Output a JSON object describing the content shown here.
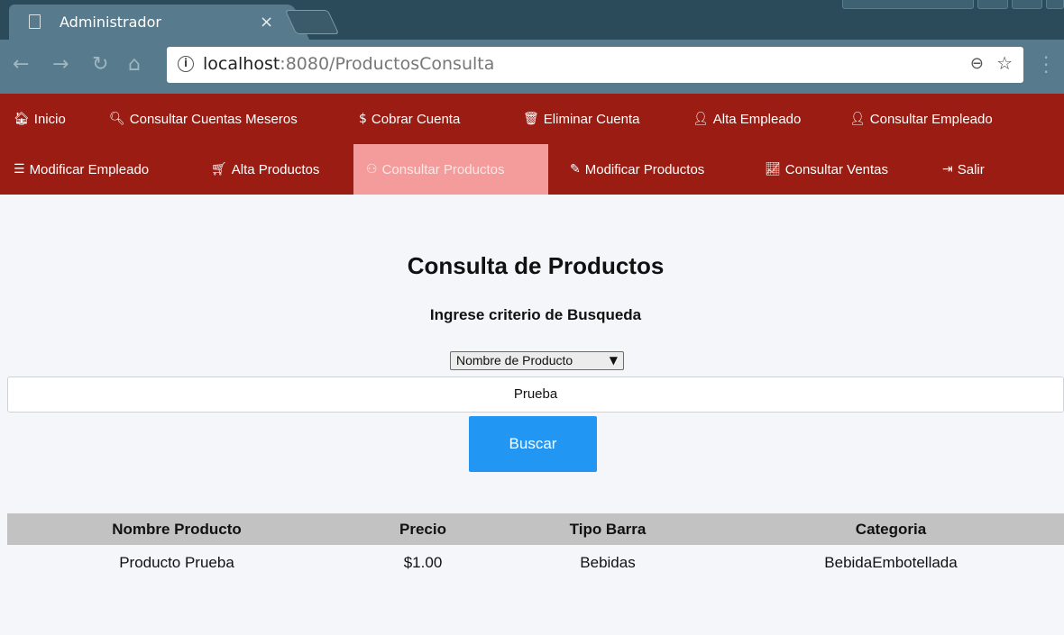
{
  "browser": {
    "tab_title": "Administrador",
    "tab_close": "×",
    "url_host": "localhost",
    "url_path": ":8080/ProductosConsulta",
    "icons": [
      "page-icon",
      "back-icon",
      "forward-icon",
      "reload-icon",
      "home-icon",
      "info-icon",
      "zoom-icon",
      "star-icon",
      "menu-icon"
    ]
  },
  "nav": {
    "accent": "#9a1c12",
    "active_color": "#f49b9b",
    "items": [
      {
        "label": "Inicio",
        "icon": "home-icon"
      },
      {
        "label": "Consultar Cuentas Meseros",
        "icon": "search-icon"
      },
      {
        "label": "Cobrar Cuenta",
        "icon": "dollar-icon"
      },
      {
        "label": "Eliminar Cuenta",
        "icon": "trash-icon"
      },
      {
        "label": "Alta Empleado",
        "icon": "user-add-icon"
      },
      {
        "label": "Consultar Empleado",
        "icon": "user-icon"
      },
      {
        "label": "Modificar Empleado",
        "icon": "list-icon"
      },
      {
        "label": "Alta Productos",
        "icon": "cart-icon"
      },
      {
        "label": "Consultar Productos",
        "icon": "binoculars-icon",
        "active": true
      },
      {
        "label": "Modificar Productos",
        "icon": "pencil-icon"
      },
      {
        "label": "Consultar Ventas",
        "icon": "chart-icon"
      },
      {
        "label": "Salir",
        "icon": "exit-icon"
      }
    ]
  },
  "main": {
    "title": "Consulta de Productos",
    "subtitle": "Ingrese criterio de Busqueda",
    "criteria_selected": "Nombre de Producto",
    "search_value": "Prueba",
    "search_button": "Buscar",
    "button_color": "#2196f3"
  },
  "table": {
    "headers": [
      "Nombre Producto",
      "Precio",
      "Tipo Barra",
      "Categoria"
    ],
    "rows": [
      [
        "Producto Prueba",
        "$1.00",
        "Bebidas",
        "BebidaEmbotellada"
      ]
    ]
  }
}
